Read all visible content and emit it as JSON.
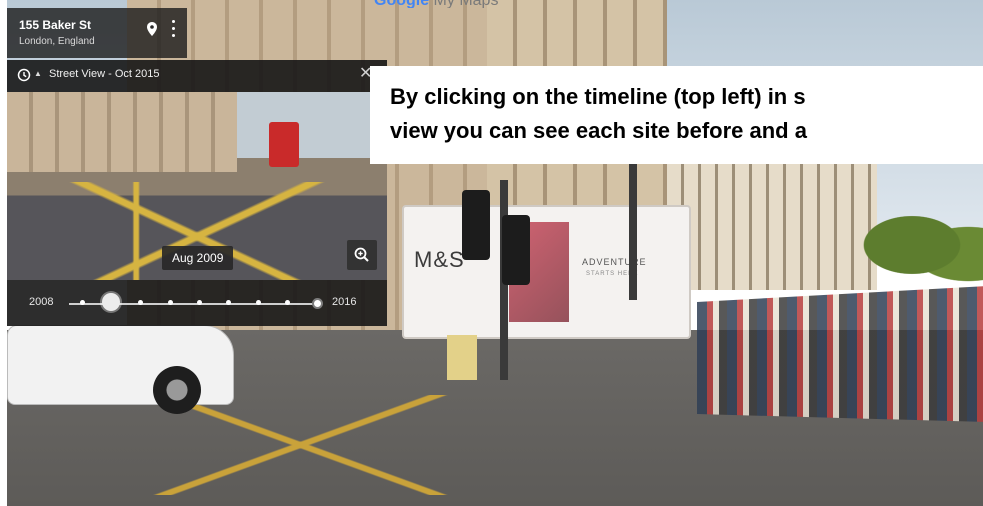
{
  "app": {
    "watermark_prefix": "Google",
    "watermark_suffix": " My Maps"
  },
  "location": {
    "name": "155 Baker St",
    "subtitle": "London, England",
    "pin_icon": "pin-icon",
    "more_icon": "more-vert-icon"
  },
  "timeline": {
    "title": "Street View - Oct 2015",
    "history_icon": "history-icon",
    "close_icon": "close-icon",
    "close_glyph": "✕",
    "caret_glyph": "▲",
    "selected_date": "Aug 2009",
    "zoom_icon": "zoom-in-icon",
    "range_start": "2008",
    "range_end": "2016",
    "stops_count": 9,
    "selected_stop_index": 1,
    "current_stop_index": 8
  },
  "scene": {
    "truck_brand": "M&S",
    "truck_tagline": "ADVENTURE",
    "truck_tagline_sub": "STARTS HERE"
  },
  "caption": {
    "line1": "By clicking on the timeline (top left) in s",
    "line2": "view you can see each site before and a"
  }
}
